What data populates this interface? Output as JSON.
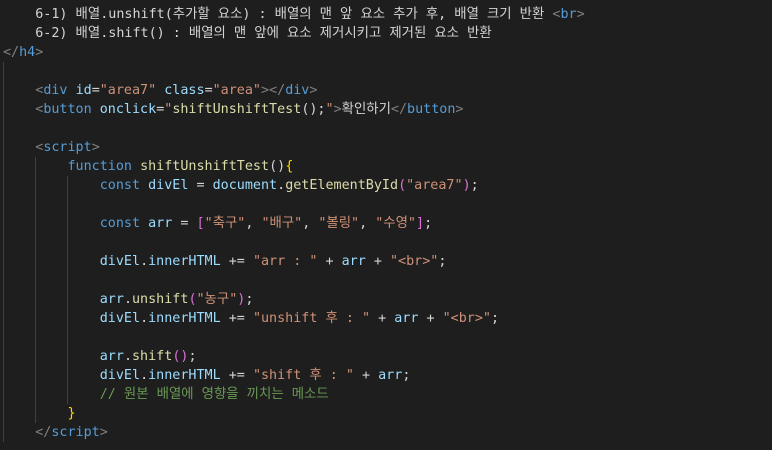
{
  "editor": {
    "lines": [
      {
        "tokens": [
          {
            "t": "    6-1) 배열.unshift(추가할 요소) : 배열의 맨 앞 요소 추가 후, 배열 크기 반환 ",
            "c": "text"
          },
          {
            "t": "<",
            "c": "punct"
          },
          {
            "t": "br",
            "c": "tag"
          },
          {
            "t": ">",
            "c": "punct"
          }
        ]
      },
      {
        "tokens": [
          {
            "t": "    6-2) 배열.shift() : 배열의 맨 앞에 요소 제거시키고 제거된 요소 반환",
            "c": "text"
          }
        ]
      },
      {
        "tokens": [
          {
            "t": "</",
            "c": "punct"
          },
          {
            "t": "h4",
            "c": "tag"
          },
          {
            "t": ">",
            "c": "punct"
          }
        ]
      },
      {
        "tokens": []
      },
      {
        "tokens": [
          {
            "t": "    ",
            "c": "text"
          },
          {
            "t": "<",
            "c": "punct"
          },
          {
            "t": "div",
            "c": "tag"
          },
          {
            "t": " ",
            "c": "text"
          },
          {
            "t": "id",
            "c": "attr"
          },
          {
            "t": "=",
            "c": "text"
          },
          {
            "t": "\"area7\"",
            "c": "str"
          },
          {
            "t": " ",
            "c": "text"
          },
          {
            "t": "class",
            "c": "attr"
          },
          {
            "t": "=",
            "c": "text"
          },
          {
            "t": "\"area\"",
            "c": "str"
          },
          {
            "t": "></",
            "c": "punct"
          },
          {
            "t": "div",
            "c": "tag"
          },
          {
            "t": ">",
            "c": "punct"
          }
        ]
      },
      {
        "tokens": [
          {
            "t": "    ",
            "c": "text"
          },
          {
            "t": "<",
            "c": "punct"
          },
          {
            "t": "button",
            "c": "tag"
          },
          {
            "t": " ",
            "c": "text"
          },
          {
            "t": "onclick",
            "c": "attr"
          },
          {
            "t": "=",
            "c": "text"
          },
          {
            "t": "\"",
            "c": "str"
          },
          {
            "t": "shiftUnshiftTest",
            "c": "fn"
          },
          {
            "t": "();",
            "c": "text"
          },
          {
            "t": "\"",
            "c": "str"
          },
          {
            "t": ">",
            "c": "punct"
          },
          {
            "t": "확인하기",
            "c": "text"
          },
          {
            "t": "</",
            "c": "punct"
          },
          {
            "t": "button",
            "c": "tag"
          },
          {
            "t": ">",
            "c": "punct"
          }
        ]
      },
      {
        "tokens": []
      },
      {
        "tokens": [
          {
            "t": "    ",
            "c": "text"
          },
          {
            "t": "<",
            "c": "punct"
          },
          {
            "t": "script",
            "c": "tag"
          },
          {
            "t": ">",
            "c": "punct"
          }
        ]
      },
      {
        "tokens": [
          {
            "t": "        ",
            "c": "text"
          },
          {
            "t": "function",
            "c": "kw"
          },
          {
            "t": " ",
            "c": "text"
          },
          {
            "t": "shiftUnshiftTest",
            "c": "fn"
          },
          {
            "t": "()",
            "c": "text"
          },
          {
            "t": "{",
            "c": "brace"
          }
        ]
      },
      {
        "tokens": [
          {
            "t": "            ",
            "c": "text"
          },
          {
            "t": "const",
            "c": "kw"
          },
          {
            "t": " ",
            "c": "text"
          },
          {
            "t": "divEl",
            "c": "var"
          },
          {
            "t": " = ",
            "c": "text"
          },
          {
            "t": "document",
            "c": "var"
          },
          {
            "t": ".",
            "c": "text"
          },
          {
            "t": "getElementById",
            "c": "fn"
          },
          {
            "t": "(",
            "c": "brace2"
          },
          {
            "t": "\"area7\"",
            "c": "str"
          },
          {
            "t": ")",
            "c": "brace2"
          },
          {
            "t": ";",
            "c": "text"
          }
        ]
      },
      {
        "tokens": []
      },
      {
        "tokens": [
          {
            "t": "            ",
            "c": "text"
          },
          {
            "t": "const",
            "c": "kw"
          },
          {
            "t": " ",
            "c": "text"
          },
          {
            "t": "arr",
            "c": "var"
          },
          {
            "t": " = ",
            "c": "text"
          },
          {
            "t": "[",
            "c": "brace2"
          },
          {
            "t": "\"축구\"",
            "c": "str"
          },
          {
            "t": ", ",
            "c": "text"
          },
          {
            "t": "\"배구\"",
            "c": "str"
          },
          {
            "t": ", ",
            "c": "text"
          },
          {
            "t": "\"볼링\"",
            "c": "str"
          },
          {
            "t": ", ",
            "c": "text"
          },
          {
            "t": "\"수영\"",
            "c": "str"
          },
          {
            "t": "]",
            "c": "brace2"
          },
          {
            "t": ";",
            "c": "text"
          }
        ]
      },
      {
        "tokens": []
      },
      {
        "tokens": [
          {
            "t": "            ",
            "c": "text"
          },
          {
            "t": "divEl",
            "c": "var"
          },
          {
            "t": ".",
            "c": "text"
          },
          {
            "t": "innerHTML",
            "c": "var"
          },
          {
            "t": " += ",
            "c": "text"
          },
          {
            "t": "\"arr : \"",
            "c": "str"
          },
          {
            "t": " + ",
            "c": "text"
          },
          {
            "t": "arr",
            "c": "var"
          },
          {
            "t": " + ",
            "c": "text"
          },
          {
            "t": "\"<br>\"",
            "c": "str"
          },
          {
            "t": ";",
            "c": "text"
          }
        ]
      },
      {
        "tokens": []
      },
      {
        "tokens": [
          {
            "t": "            ",
            "c": "text"
          },
          {
            "t": "arr",
            "c": "var"
          },
          {
            "t": ".",
            "c": "text"
          },
          {
            "t": "unshift",
            "c": "fn"
          },
          {
            "t": "(",
            "c": "brace2"
          },
          {
            "t": "\"농구\"",
            "c": "str"
          },
          {
            "t": ")",
            "c": "brace2"
          },
          {
            "t": ";",
            "c": "text"
          }
        ]
      },
      {
        "tokens": [
          {
            "t": "            ",
            "c": "text"
          },
          {
            "t": "divEl",
            "c": "var"
          },
          {
            "t": ".",
            "c": "text"
          },
          {
            "t": "innerHTML",
            "c": "var"
          },
          {
            "t": " += ",
            "c": "text"
          },
          {
            "t": "\"unshift 후 : \"",
            "c": "str"
          },
          {
            "t": " + ",
            "c": "text"
          },
          {
            "t": "arr",
            "c": "var"
          },
          {
            "t": " + ",
            "c": "text"
          },
          {
            "t": "\"<br>\"",
            "c": "str"
          },
          {
            "t": ";",
            "c": "text"
          }
        ]
      },
      {
        "tokens": []
      },
      {
        "tokens": [
          {
            "t": "            ",
            "c": "text"
          },
          {
            "t": "arr",
            "c": "var"
          },
          {
            "t": ".",
            "c": "text"
          },
          {
            "t": "shift",
            "c": "fn"
          },
          {
            "t": "()",
            "c": "brace2"
          },
          {
            "t": ";",
            "c": "text"
          }
        ]
      },
      {
        "tokens": [
          {
            "t": "            ",
            "c": "text"
          },
          {
            "t": "divEl",
            "c": "var"
          },
          {
            "t": ".",
            "c": "text"
          },
          {
            "t": "innerHTML",
            "c": "var"
          },
          {
            "t": " += ",
            "c": "text"
          },
          {
            "t": "\"shift 후 : \"",
            "c": "str"
          },
          {
            "t": " + ",
            "c": "text"
          },
          {
            "t": "arr",
            "c": "var"
          },
          {
            "t": ";",
            "c": "text"
          }
        ]
      },
      {
        "tokens": [
          {
            "t": "            ",
            "c": "text"
          },
          {
            "t": "// 원본 배열에 영향을 끼치는 메소드",
            "c": "comment"
          }
        ]
      },
      {
        "tokens": [
          {
            "t": "        ",
            "c": "text"
          },
          {
            "t": "}",
            "c": "brace"
          }
        ]
      },
      {
        "tokens": [
          {
            "t": "    ",
            "c": "text"
          },
          {
            "t": "</",
            "c": "punct"
          },
          {
            "t": "script",
            "c": "tag"
          },
          {
            "t": ">",
            "c": "punct"
          }
        ]
      }
    ]
  }
}
